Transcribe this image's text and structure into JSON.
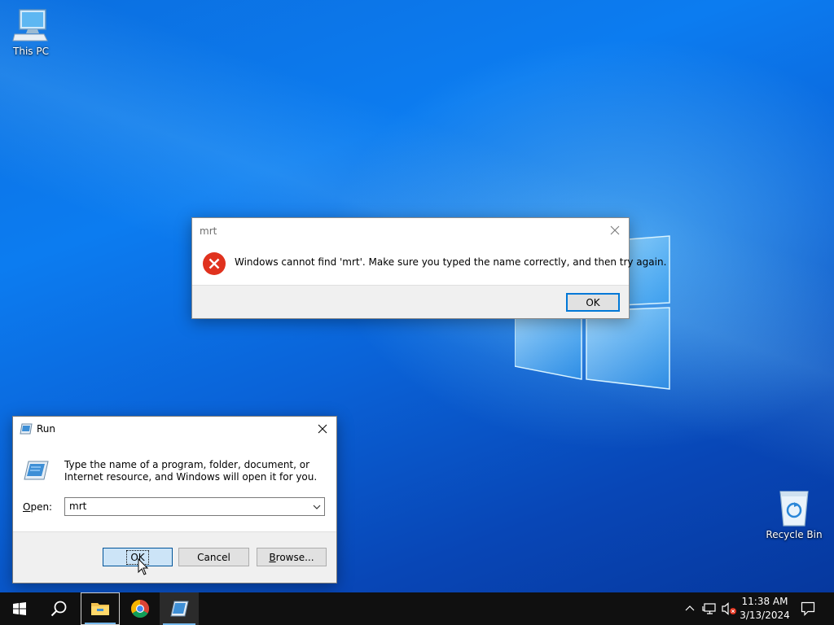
{
  "desktop": {
    "icons": [
      {
        "label": "This PC"
      },
      {
        "label": "Recycle Bin"
      }
    ]
  },
  "error_dialog": {
    "title": "mrt",
    "message": "Windows cannot find 'mrt'. Make sure you typed the name correctly, and then try again.",
    "ok_label": "OK"
  },
  "run_dialog": {
    "title": "Run",
    "description": "Type the name of a program, folder, document, or Internet resource, and Windows will open it for you.",
    "open_label_prefix": "O",
    "open_label_rest": "pen:",
    "open_value": "mrt",
    "ok_label": "OK",
    "cancel_label": "Cancel",
    "browse_label_prefix": "B",
    "browse_label_rest": "rowse..."
  },
  "taskbar": {
    "items": [
      "start-icon",
      "search-icon",
      "file-explorer-icon",
      "chrome-icon",
      "run-icon"
    ],
    "tray_icons": [
      "chevron-up-icon",
      "network-icon",
      "volume-muted-icon",
      "notifications-icon"
    ],
    "time": "11:38 AM",
    "date": "3/13/2024"
  },
  "colors": {
    "desktop_blue": "#0a63d8",
    "error_red": "#e0321e",
    "accent": "#0078d7",
    "taskbar": "#101010"
  }
}
